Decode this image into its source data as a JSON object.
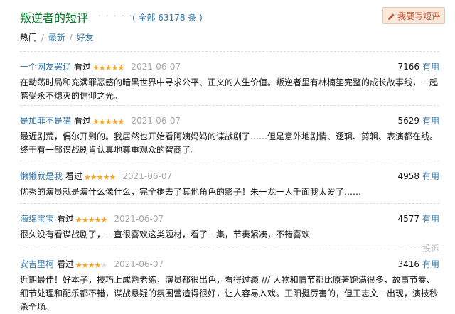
{
  "header": {
    "title": "叛逆者的短评",
    "dots": "· · · · · ·",
    "count": "( 全部 63178 条 )",
    "write_label": "我要写短评"
  },
  "tabs": {
    "hot": "热门",
    "sep": "/",
    "latest": "最新",
    "friends": "好友"
  },
  "comments": [
    {
      "user": "一个网友罢辽",
      "seen": "看过",
      "rating": 5,
      "date": "2021-06-07",
      "votes": "7166",
      "useful": "有用",
      "text": "在动荡时局和充满罪恶感的暗黑世界中寻求公平、正义的人生价值。叛逆者里有林楠笙完整的成长故事线，一起感受永不熄灭的信仰之光。"
    },
    {
      "user": "是加菲不是猫",
      "seen": "看过",
      "rating": 5,
      "date": "2021-06-07",
      "votes": "5629",
      "useful": "有用",
      "text": "最近剧荒，偶尔开到的。我居然也开始看阿姨妈妈的谍战剧了……但是意外地剧情、逻辑、剪辑、表演都在线。终于有一部谍战剧肯认真地尊重观众的智商了。"
    },
    {
      "user": "懒懒就是我",
      "seen": "看过",
      "rating": 5,
      "date": "2021-06-07",
      "votes": "4958",
      "useful": "有用",
      "text": "优秀的演员就是演什么像什么，完全褪去了其他角色的影子！朱一龙一人千面我太爱了……"
    },
    {
      "user": "海绵宝宝",
      "seen": "看过",
      "rating": 5,
      "date": "2021-06-07",
      "votes": "4577",
      "useful": "有用",
      "text": "很久没有看谍战剧了，一直很喜欢这类题材，看了一集，节奏紧凑，不错喜欢",
      "report": "投诉"
    },
    {
      "user": "安吉里柯",
      "seen": "看过",
      "rating": 4,
      "date": "2021-06-07",
      "votes": "3416",
      "useful": "有用",
      "text": "近期最佳！好本子，技巧上成熟老练，演员都很出色，看得过瘾 /// 人物和情节都比原著饱满很多，故事节奏、细节处理和配乐都不错，谍战悬疑的氛围营造得很好，让人容易入戏。王阳挺厉害的，但王志文一出现，演技秒杀全场。"
    }
  ],
  "colors": {
    "title": "#007722",
    "link": "#3377aa",
    "star": "#f5a623",
    "button_bg": "#fae9da",
    "button_text": "#c0573a"
  }
}
